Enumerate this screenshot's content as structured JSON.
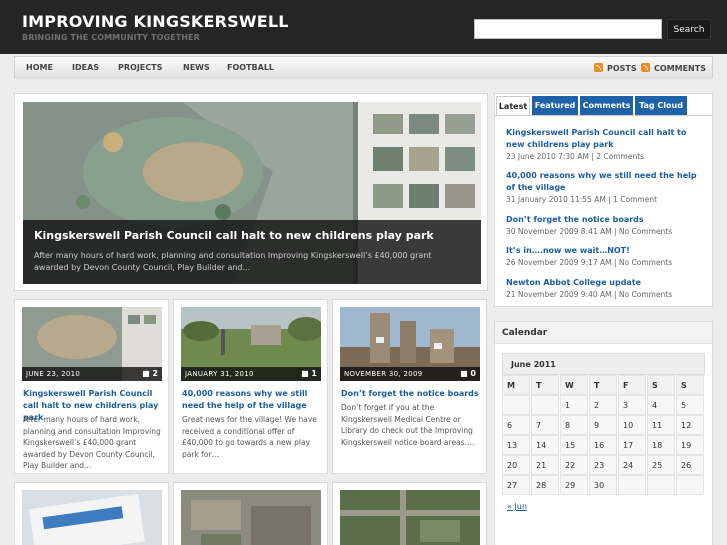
{
  "site": {
    "title": "IMPROVING KINGSKERSWELL",
    "tagline": "BRINGING THE COMMUNITY TOGETHER"
  },
  "search": {
    "placeholder": "",
    "button": "Search"
  },
  "nav": {
    "items": [
      "HOME",
      "IDEAS",
      "PROJECTS",
      "NEWS",
      "FOOTBALL"
    ],
    "feeds": [
      "POSTS",
      "COMMENTS"
    ]
  },
  "featured": {
    "title": "Kingskerswell Parish Council call halt to new childrens play park",
    "excerpt": "After many hours of hard work, planning and consultation Improving Kingskerswell’s £40,000 grant awarded by Devon County Council, Play Builder and..."
  },
  "posts": [
    {
      "date": "JUNE 23, 2010",
      "comments": "2",
      "title": "Kingskerswell Parish Council call halt to new childrens play park",
      "excerpt": "After many hours of hard work, planning and consultation Improving Kingskerswell’s £40,000 grant awarded by Devon County Council, Play Builder and..."
    },
    {
      "date": "JANUARY 31, 2010",
      "comments": "1",
      "title": "40,000 reasons why we still need the help of the village",
      "excerpt": "Great news for the village! We have received a conditional offer of £40,000 to go towards a new play park for…"
    },
    {
      "date": "NOVEMBER 30, 2009",
      "comments": "0",
      "title": "Don’t forget the notice boards",
      "excerpt": "Don’t forget if you at the Kingskerswell Medical Centre or Library do check out the Improving Kingskerswell notice board areas…."
    }
  ],
  "tabs": [
    "Latest",
    "Featured",
    "Comments",
    "Tag Cloud"
  ],
  "latest": [
    {
      "title": "Kingskerswell Parish Council call halt to new childrens play park",
      "meta": "23 June 2010 7:30 AM | 2 Comments"
    },
    {
      "title": "40,000 reasons why we still need the help of the village",
      "meta": "31 January 2010 11:55 AM | 1 Comment"
    },
    {
      "title": "Don’t forget the notice boards",
      "meta": "30 November 2009 8:41 AM | No Comments"
    },
    {
      "title": "It’s in….now we wait…NOT!",
      "meta": "26 November 2009 9:17 AM | No Comments"
    },
    {
      "title": "Newton Abbot College update",
      "meta": "21 November 2009 9:40 AM | No Comments"
    }
  ],
  "calendar": {
    "heading": "Calendar",
    "month": "June 2011",
    "days": [
      "M",
      "T",
      "W",
      "T",
      "F",
      "S",
      "S"
    ],
    "weeks": [
      [
        "",
        "",
        "1",
        "2",
        "3",
        "4",
        "5"
      ],
      [
        "6",
        "7",
        "8",
        "9",
        "10",
        "11",
        "12"
      ],
      [
        "13",
        "14",
        "15",
        "16",
        "17",
        "18",
        "19"
      ],
      [
        "20",
        "21",
        "22",
        "23",
        "24",
        "25",
        "26"
      ],
      [
        "27",
        "28",
        "29",
        "30",
        "",
        "",
        ""
      ]
    ],
    "prev": "« Jun"
  },
  "colors": {
    "header_bg": "#252525",
    "link": "#1b5e9e",
    "tab_blue": "#1e62a8",
    "feed_orange": "#f08a24"
  }
}
